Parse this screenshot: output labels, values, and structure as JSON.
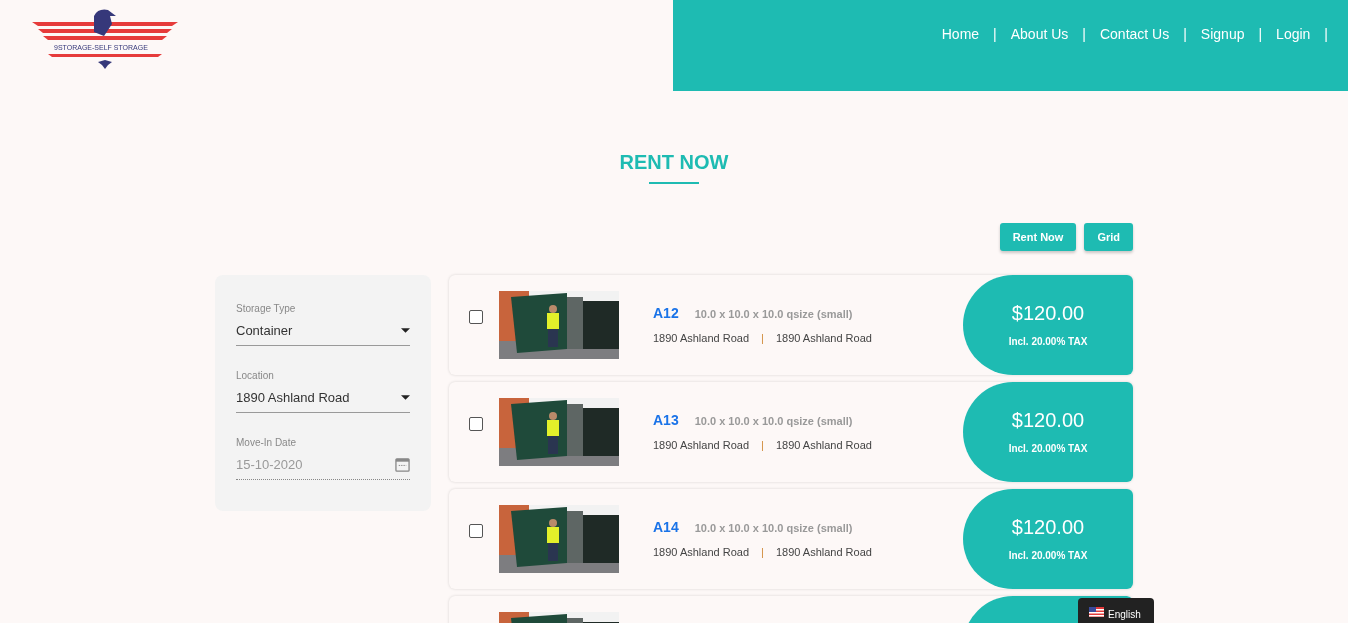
{
  "logo": {
    "text": "9STORAGE-SELF STORAGE"
  },
  "nav": [
    {
      "label": "Home",
      "separator": "|"
    },
    {
      "label": "About Us",
      "separator": "|"
    },
    {
      "label": "Contact Us",
      "separator": "|"
    },
    {
      "label": "Signup",
      "separator": "|"
    },
    {
      "label": "Login",
      "separator": "|"
    }
  ],
  "heading": "RENT NOW",
  "view_buttons": [
    {
      "label": "Rent Now"
    },
    {
      "label": "Grid"
    }
  ],
  "filters": [
    {
      "kind": "select",
      "label": "Storage Type",
      "value": "Container"
    },
    {
      "kind": "select",
      "label": "Location",
      "value": "1890 Ashland Road"
    },
    {
      "kind": "date",
      "label": "Move-In Date",
      "placeholder": "15-10-2020"
    }
  ],
  "units": [
    {
      "kind": "full",
      "checked": false,
      "name": "A12",
      "size": "10.0 x 10.0 x 10.0 qsize (small)",
      "address": "1890 Ashland Road",
      "separator": "|",
      "location": "1890 Ashland Road",
      "price": "$120.00",
      "tax": "Incl. 20.00% TAX"
    },
    {
      "kind": "full",
      "checked": false,
      "name": "A13",
      "size": "10.0 x 10.0 x 10.0 qsize (small)",
      "address": "1890 Ashland Road",
      "separator": "|",
      "location": "1890 Ashland Road",
      "price": "$120.00",
      "tax": "Incl. 20.00% TAX"
    },
    {
      "kind": "full",
      "checked": false,
      "name": "A14",
      "size": "10.0 x 10.0 x 10.0 qsize (small)",
      "address": "1890 Ashland Road",
      "separator": "|",
      "location": "1890 Ashland Road",
      "price": "$120.00",
      "tax": "Incl. 20.00% TAX"
    },
    {
      "kind": "partial"
    }
  ],
  "language": {
    "label": "English"
  }
}
